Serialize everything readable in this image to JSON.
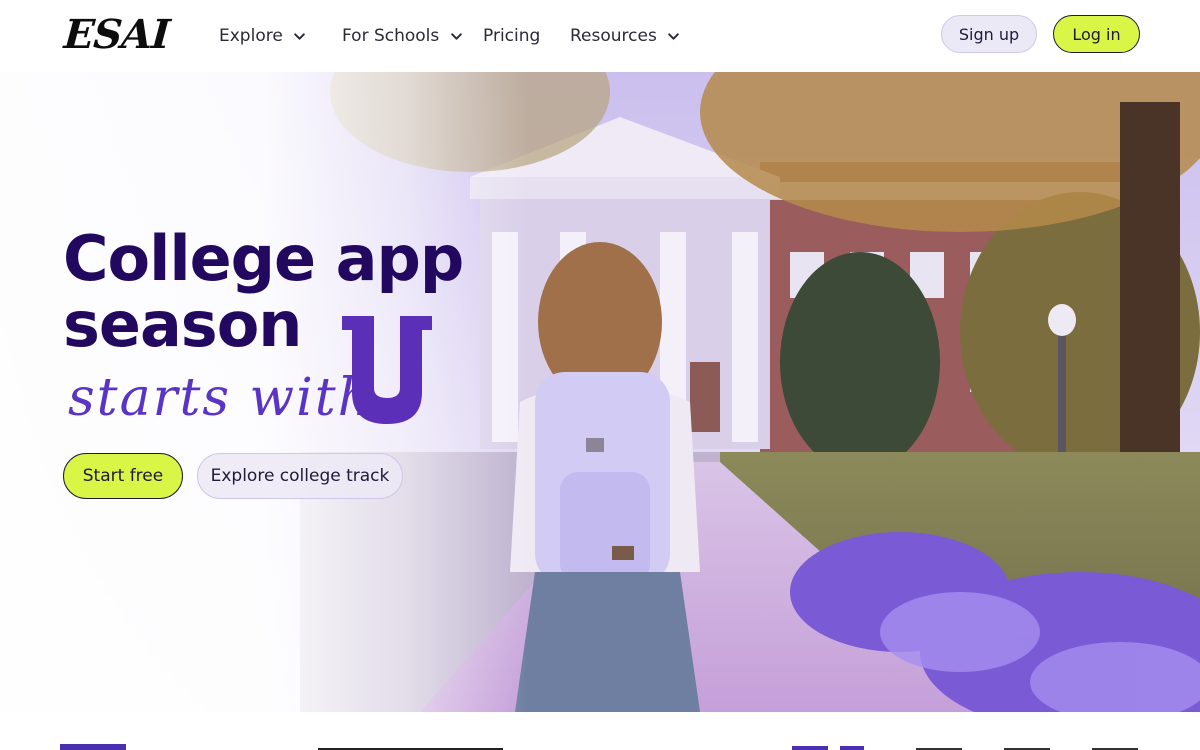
{
  "header": {
    "logo_text": "ESAI",
    "nav": [
      {
        "label": "Explore",
        "has_dropdown": true,
        "icon": "chevron-down-icon"
      },
      {
        "label": "For Schools",
        "has_dropdown": true,
        "icon": "chevron-down-icon"
      },
      {
        "label": "Pricing",
        "has_dropdown": false
      },
      {
        "label": "Resources",
        "has_dropdown": true,
        "icon": "chevron-down-icon"
      }
    ],
    "signup_label": "Sign up",
    "login_label": "Log in"
  },
  "hero": {
    "title_line1": "College app",
    "title_line2": "season",
    "script_text": "starts with",
    "emblem_letter": "U",
    "start_label": "Start free",
    "explore_label": "Explore college track"
  },
  "colors": {
    "accent": "#d9f545",
    "brand_purple": "#22085e",
    "script_purple": "#5a34c4",
    "emblem_purple": "#5b2fb8",
    "soft_lavender": "#ece9f6"
  }
}
